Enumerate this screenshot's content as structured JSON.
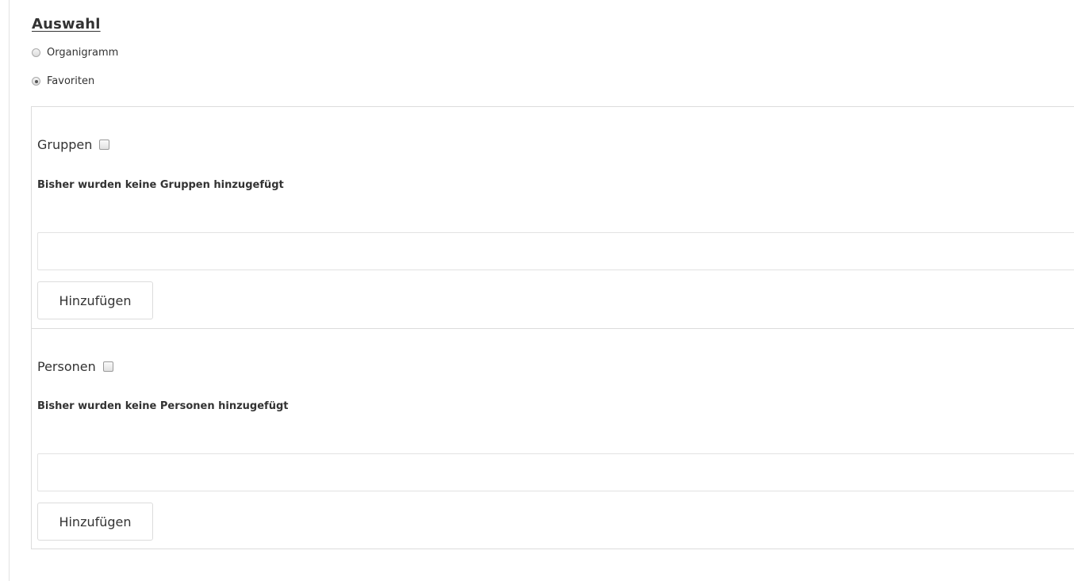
{
  "selection": {
    "heading": "Auswahl",
    "options": [
      {
        "label": "Organigramm",
        "checked": false
      },
      {
        "label": "Favoriten",
        "checked": true
      }
    ]
  },
  "groups": {
    "title": "Gruppen",
    "checked": false,
    "empty_message": "Bisher wurden keine Gruppen hinzugefügt",
    "input_value": "",
    "add_button_label": "Hinzufügen"
  },
  "persons": {
    "title": "Personen",
    "checked": false,
    "empty_message": "Bisher wurden keine Personen hinzugefügt",
    "input_value": "",
    "add_button_label": "Hinzufügen"
  }
}
